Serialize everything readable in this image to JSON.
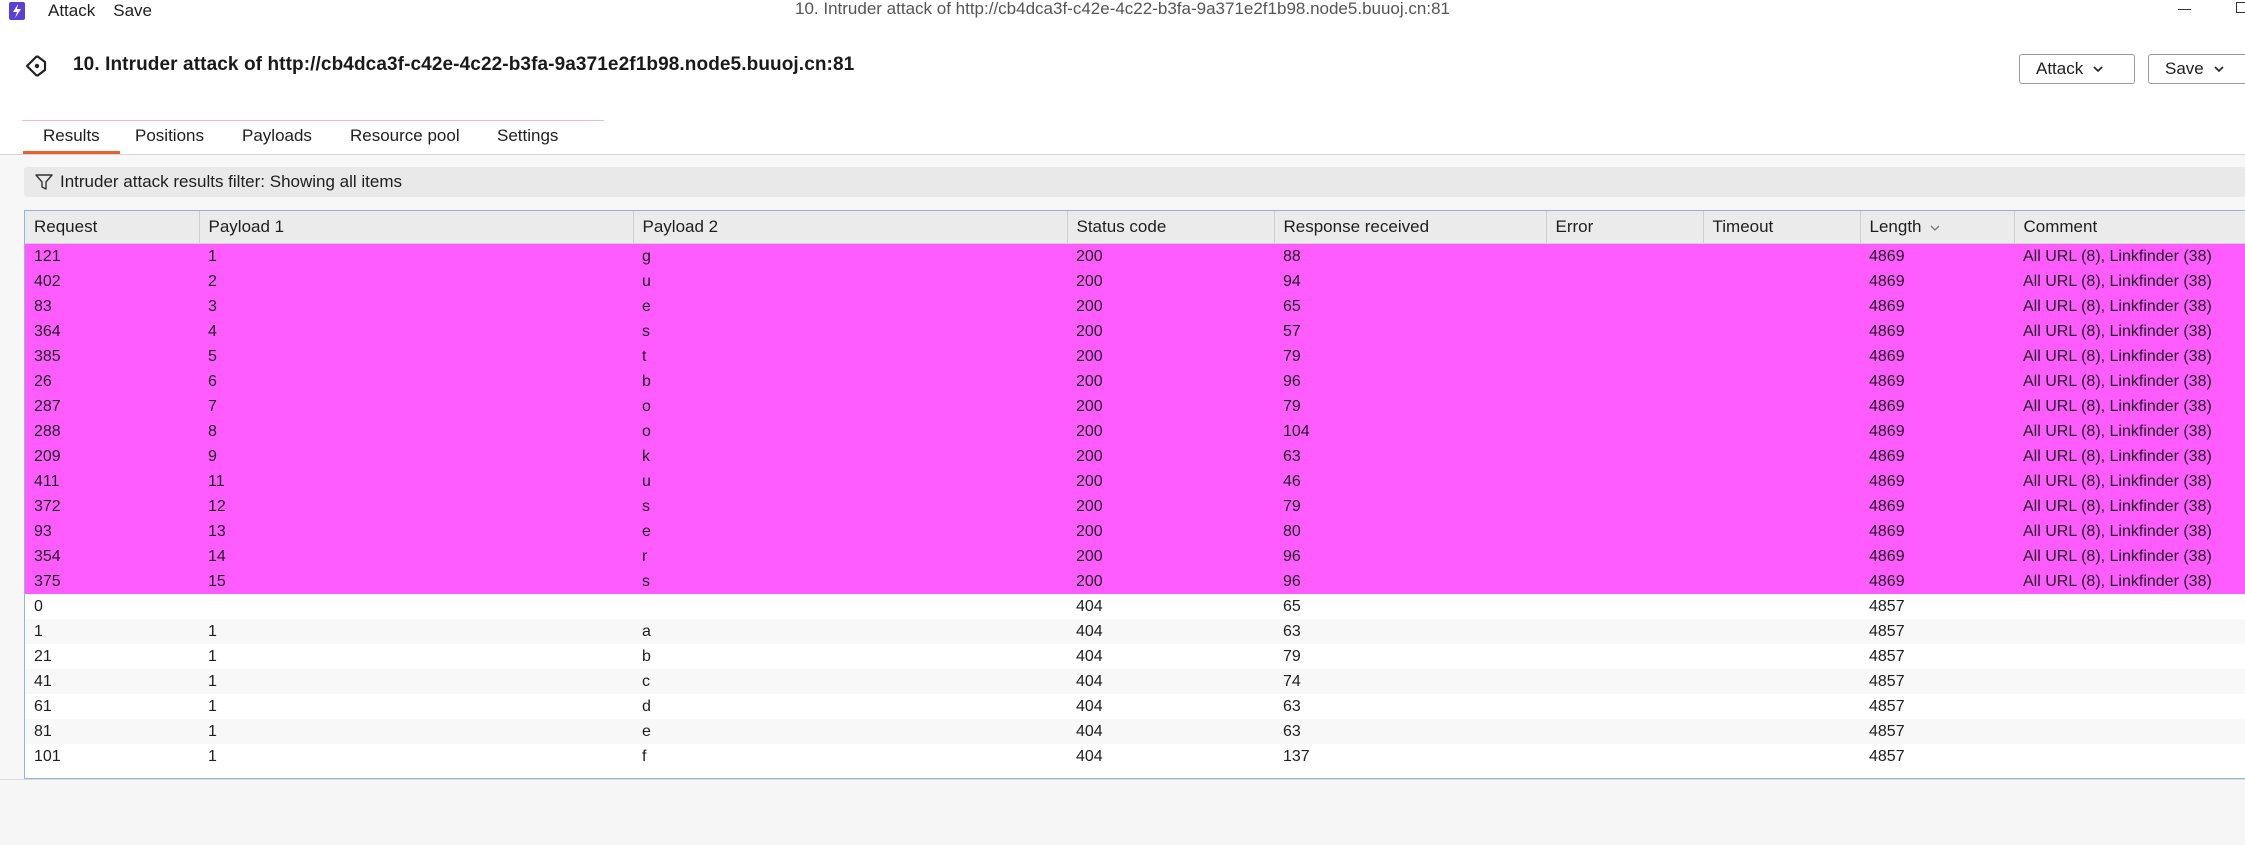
{
  "titlebar": {
    "menu": [
      "Attack",
      "Save"
    ],
    "window_title": "10. Intruder attack of http://cb4dca3f-c42e-4c22-b3fa-9a371e2f1b98.node5.buuoj.cn:81"
  },
  "header": {
    "title": "10. Intruder attack of http://cb4dca3f-c42e-4c22-b3fa-9a371e2f1b98.node5.buuoj.cn:81",
    "attack_label": "Attack",
    "save_label": "Save"
  },
  "tabs": [
    {
      "label": "Results",
      "active": true
    },
    {
      "label": "Positions",
      "active": false
    },
    {
      "label": "Payloads",
      "active": false
    },
    {
      "label": "Resource pool",
      "active": false
    },
    {
      "label": "Settings",
      "active": false
    }
  ],
  "filter": {
    "text": "Intruder attack results filter: Showing all items"
  },
  "table": {
    "columns": [
      "Request",
      "Payload 1",
      "Payload 2",
      "Status code",
      "Response received",
      "Error",
      "Timeout",
      "Length",
      "Comment"
    ],
    "sorted_column": "Length",
    "rows": [
      {
        "cells": [
          "121",
          "1",
          "g",
          "200",
          "88",
          "",
          "",
          "4869",
          "All URL (8), Linkfinder (38)"
        ],
        "highlight": true
      },
      {
        "cells": [
          "402",
          "2",
          "u",
          "200",
          "94",
          "",
          "",
          "4869",
          "All URL (8), Linkfinder (38)"
        ],
        "highlight": true
      },
      {
        "cells": [
          "83",
          "3",
          "e",
          "200",
          "65",
          "",
          "",
          "4869",
          "All URL (8), Linkfinder (38)"
        ],
        "highlight": true
      },
      {
        "cells": [
          "364",
          "4",
          "s",
          "200",
          "57",
          "",
          "",
          "4869",
          "All URL (8), Linkfinder (38)"
        ],
        "highlight": true
      },
      {
        "cells": [
          "385",
          "5",
          "t",
          "200",
          "79",
          "",
          "",
          "4869",
          "All URL (8), Linkfinder (38)"
        ],
        "highlight": true
      },
      {
        "cells": [
          "26",
          "6",
          "b",
          "200",
          "96",
          "",
          "",
          "4869",
          "All URL (8), Linkfinder (38)"
        ],
        "highlight": true
      },
      {
        "cells": [
          "287",
          "7",
          "o",
          "200",
          "79",
          "",
          "",
          "4869",
          "All URL (8), Linkfinder (38)"
        ],
        "highlight": true
      },
      {
        "cells": [
          "288",
          "8",
          "o",
          "200",
          "104",
          "",
          "",
          "4869",
          "All URL (8), Linkfinder (38)"
        ],
        "highlight": true
      },
      {
        "cells": [
          "209",
          "9",
          "k",
          "200",
          "63",
          "",
          "",
          "4869",
          "All URL (8), Linkfinder (38)"
        ],
        "highlight": true
      },
      {
        "cells": [
          "411",
          "11",
          "u",
          "200",
          "46",
          "",
          "",
          "4869",
          "All URL (8), Linkfinder (38)"
        ],
        "highlight": true
      },
      {
        "cells": [
          "372",
          "12",
          "s",
          "200",
          "79",
          "",
          "",
          "4869",
          "All URL (8), Linkfinder (38)"
        ],
        "highlight": true
      },
      {
        "cells": [
          "93",
          "13",
          "e",
          "200",
          "80",
          "",
          "",
          "4869",
          "All URL (8), Linkfinder (38)"
        ],
        "highlight": true
      },
      {
        "cells": [
          "354",
          "14",
          "r",
          "200",
          "96",
          "",
          "",
          "4869",
          "All URL (8), Linkfinder (38)"
        ],
        "highlight": true
      },
      {
        "cells": [
          "375",
          "15",
          "s",
          "200",
          "96",
          "",
          "",
          "4869",
          "All URL (8), Linkfinder (38)"
        ],
        "highlight": true
      },
      {
        "cells": [
          "0",
          "",
          "",
          "404",
          "65",
          "",
          "",
          "4857",
          ""
        ],
        "highlight": false
      },
      {
        "cells": [
          "1",
          "1",
          "a",
          "404",
          "63",
          "",
          "",
          "4857",
          ""
        ],
        "highlight": false
      },
      {
        "cells": [
          "21",
          "1",
          "b",
          "404",
          "79",
          "",
          "",
          "4857",
          ""
        ],
        "highlight": false
      },
      {
        "cells": [
          "41",
          "1",
          "c",
          "404",
          "74",
          "",
          "",
          "4857",
          ""
        ],
        "highlight": false
      },
      {
        "cells": [
          "61",
          "1",
          "d",
          "404",
          "63",
          "",
          "",
          "4857",
          ""
        ],
        "highlight": false
      },
      {
        "cells": [
          "81",
          "1",
          "e",
          "404",
          "63",
          "",
          "",
          "4857",
          ""
        ],
        "highlight": false
      },
      {
        "cells": [
          "101",
          "1",
          "f",
          "404",
          "137",
          "",
          "",
          "4857",
          ""
        ],
        "highlight": false
      }
    ]
  },
  "colors": {
    "highlight": "#ff5cff",
    "tab_accent": "#e8612c",
    "app_icon": "#5b3fd6"
  },
  "icons": {
    "app": "lightning-icon",
    "back": "back-arrow-icon",
    "filter": "funnel-icon",
    "dropdown": "chevron-down-icon"
  }
}
